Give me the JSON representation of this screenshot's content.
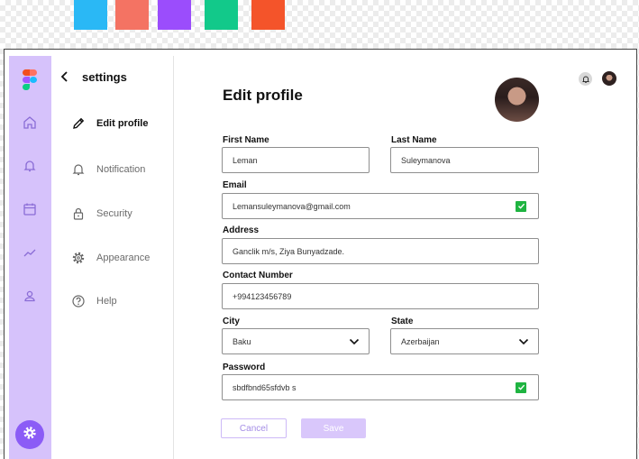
{
  "palette": {
    "swatches": [
      "#2ab8f5",
      "#f47363",
      "#9b4dfc",
      "#12c98a",
      "#f4542a"
    ]
  },
  "rail": {
    "icons": [
      "home-icon",
      "bell-icon",
      "calendar-icon",
      "chart-icon",
      "user-icon",
      "gear-icon"
    ],
    "background": "#d6c2fb",
    "accent": "#8b5cf6"
  },
  "settings": {
    "title": "settings",
    "back_icon": "chevron-left-icon",
    "menu": [
      {
        "label": "Edit profile",
        "icon": "pencil-icon",
        "active": true
      },
      {
        "label": "Notification",
        "icon": "bell-icon",
        "active": false
      },
      {
        "label": "Security",
        "icon": "lock-icon",
        "active": false
      },
      {
        "label": "Appearance",
        "icon": "gear-icon",
        "active": false
      },
      {
        "label": "Help",
        "icon": "help-icon",
        "active": false
      }
    ]
  },
  "main": {
    "title": "Edit profile",
    "form": {
      "first_name": {
        "label": "First Name",
        "value": "Leman"
      },
      "last_name": {
        "label": "Last Name",
        "value": "Suleymanova"
      },
      "email": {
        "label": "Email",
        "value": "Lemansuleymanova@gmail.com",
        "verified": true
      },
      "address": {
        "label": "Address",
        "value": "Ganclik m/s, Ziya Bunyadzade."
      },
      "contact": {
        "label": "Contact Number",
        "value": "+994123456789"
      },
      "city": {
        "label": "City",
        "value": "Baku"
      },
      "state": {
        "label": "State",
        "value": "Azerbaijan"
      },
      "password": {
        "label": "Password",
        "value": "sbdfbnd65sfdvb s",
        "verified": true
      }
    },
    "cancel_label": "Cancel",
    "save_label": "Save"
  }
}
